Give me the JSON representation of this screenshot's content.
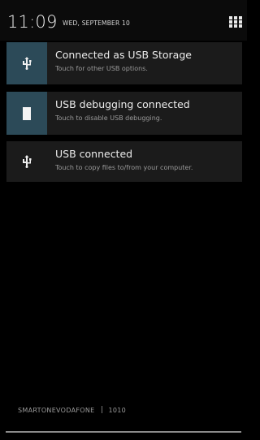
{
  "header": {
    "time": "11:09",
    "date": "WED, SEPTEMBER 10",
    "settings_icon": "quick-settings-grid-icon"
  },
  "notifications": [
    {
      "icon": "usb-icon",
      "title": "Connected as USB Storage",
      "subtitle": "Touch for other USB options.",
      "icon_bg": "#2c4a58"
    },
    {
      "icon": "bug-icon",
      "title": "USB debugging connected",
      "subtitle": "Touch to disable USB debugging.",
      "icon_bg": "#2c4a58"
    },
    {
      "icon": "usb-icon",
      "title": "USB connected",
      "subtitle": "Touch to copy files to/from your computer.",
      "icon_bg": "#1b1b1b"
    }
  ],
  "footer": {
    "carrier": "SMARTONEVODAFONE",
    "carrier2": "1010"
  },
  "colors": {
    "background": "#000000",
    "notification_bg": "#1b1b1b",
    "accent": "#2c4a58"
  }
}
